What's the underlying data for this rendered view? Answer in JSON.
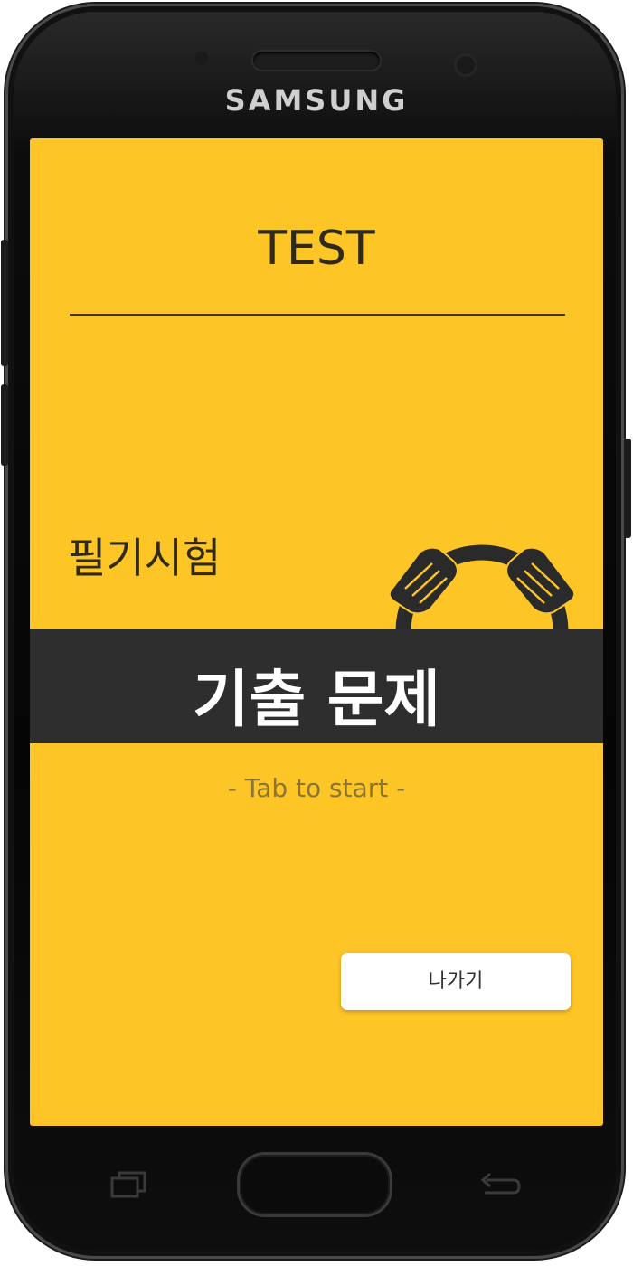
{
  "device": {
    "brand": "SAMSUNG"
  },
  "app": {
    "title": "TEST",
    "subtitle": "필기시험",
    "banner": "기출 문제",
    "hint": "- Tab to start -",
    "exit_button": "나가기"
  },
  "colors": {
    "background": "#fdc526",
    "banner": "#2e2e2e",
    "text_dark": "#2f2a1c",
    "hint": "#8a7436"
  },
  "icons": {
    "mascot": "mascot-hands-icon",
    "recent_apps": "recent-apps-icon",
    "back": "back-icon"
  }
}
